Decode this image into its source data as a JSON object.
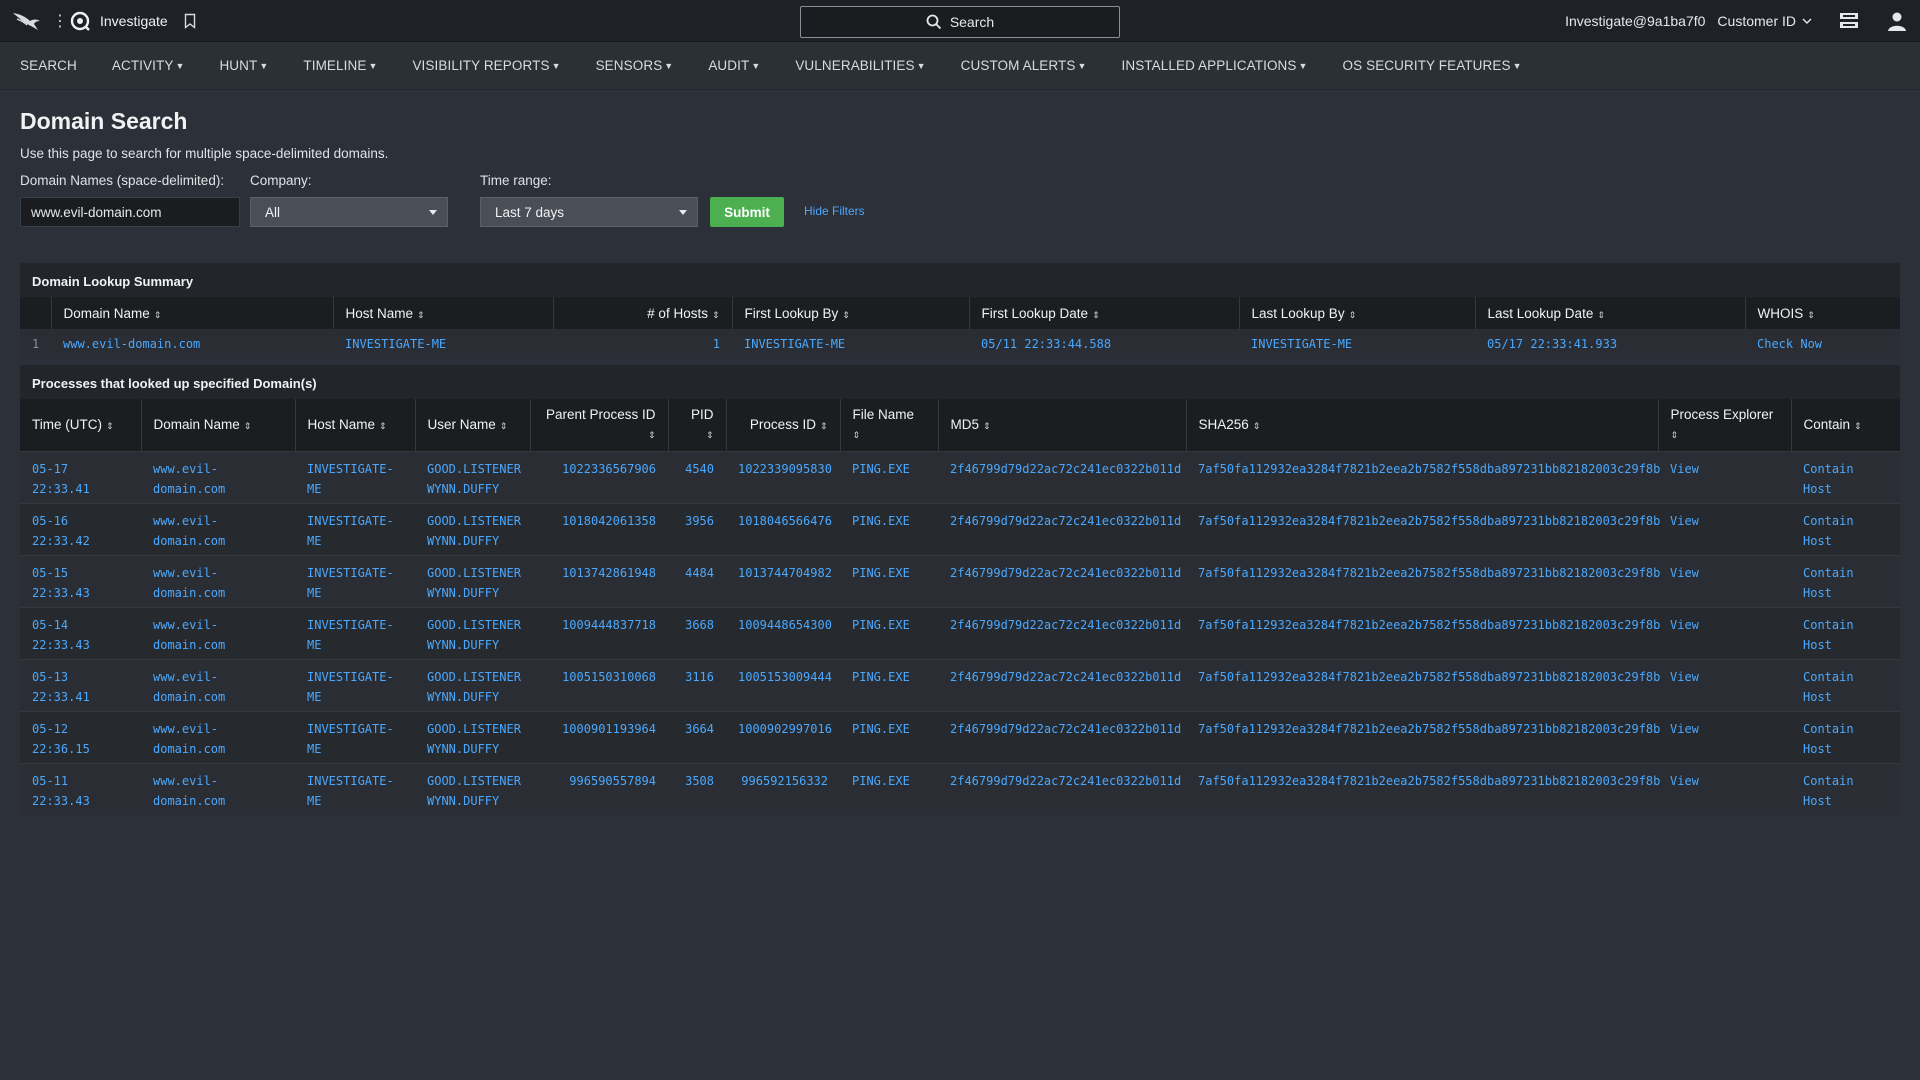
{
  "topbar": {
    "app_title": "Investigate",
    "search_label": "Search",
    "user": "Investigate@9a1ba7f0",
    "customer_label": "Customer ID"
  },
  "nav": [
    {
      "label": "SEARCH",
      "has_menu": false
    },
    {
      "label": "ACTIVITY",
      "has_menu": true
    },
    {
      "label": "HUNT",
      "has_menu": true
    },
    {
      "label": "TIMELINE",
      "has_menu": true
    },
    {
      "label": "VISIBILITY REPORTS",
      "has_menu": true
    },
    {
      "label": "SENSORS",
      "has_menu": true
    },
    {
      "label": "AUDIT",
      "has_menu": true
    },
    {
      "label": "VULNERABILITIES",
      "has_menu": true
    },
    {
      "label": "CUSTOM ALERTS",
      "has_menu": true
    },
    {
      "label": "INSTALLED APPLICATIONS",
      "has_menu": true
    },
    {
      "label": "OS SECURITY FEATURES",
      "has_menu": true
    }
  ],
  "page": {
    "title": "Domain Search",
    "description": "Use this page to search for multiple space-delimited domains."
  },
  "filters": {
    "domain_label": "Domain Names (space-delimited):",
    "domain_value": "www.evil-domain.com",
    "company_label": "Company:",
    "company_value": "All",
    "time_label": "Time range:",
    "time_value": "Last 7 days",
    "submit_label": "Submit",
    "hide_filters_label": "Hide Filters"
  },
  "summary": {
    "title": "Domain Lookup Summary",
    "columns": [
      "Domain Name",
      "Host Name",
      "# of Hosts",
      "First Lookup By",
      "First Lookup Date",
      "Last Lookup By",
      "Last Lookup Date",
      "WHOIS"
    ],
    "rows": [
      {
        "index": "1",
        "domain": "www.evil-domain.com",
        "host": "INVESTIGATE-ME",
        "hosts": "1",
        "first_by": "INVESTIGATE-ME",
        "first_date": "05/11 22:33:44.588",
        "last_by": "INVESTIGATE-ME",
        "last_date": "05/17 22:33:41.933",
        "whois": "Check Now"
      }
    ]
  },
  "processes": {
    "title": "Processes that looked up specified Domain(s)",
    "columns": [
      "Time (UTC)",
      "Domain Name",
      "Host Name",
      "User Name",
      "Parent Process ID",
      "PID",
      "Process ID",
      "File Name",
      "MD5",
      "SHA256",
      "Process Explorer",
      "Contain"
    ],
    "rows": [
      {
        "date": "05-17",
        "time": "22:33.41",
        "domain1": "www.evil-",
        "domain2": "domain.com",
        "host1": "INVESTIGATE-",
        "host2": "ME",
        "user1": "GOOD.LISTENER",
        "user2": "WYNN.DUFFY",
        "ppid": "1022336567906",
        "pid": "4540",
        "procid": "1022339095830",
        "file": "PING.EXE",
        "md5": "2f46799d79d22ac72c241ec0322b011d",
        "sha256": "7af50fa112932ea3284f7821b2eea2b7582f558dba897231bb82182003c29f8b",
        "explorer": "View",
        "contain1": "Contain",
        "contain2": "Host"
      },
      {
        "date": "05-16",
        "time": "22:33.42",
        "domain1": "www.evil-",
        "domain2": "domain.com",
        "host1": "INVESTIGATE-",
        "host2": "ME",
        "user1": "GOOD.LISTENER",
        "user2": "WYNN.DUFFY",
        "ppid": "1018042061358",
        "pid": "3956",
        "procid": "1018046566476",
        "file": "PING.EXE",
        "md5": "2f46799d79d22ac72c241ec0322b011d",
        "sha256": "7af50fa112932ea3284f7821b2eea2b7582f558dba897231bb82182003c29f8b",
        "explorer": "View",
        "contain1": "Contain",
        "contain2": "Host"
      },
      {
        "date": "05-15",
        "time": "22:33.43",
        "domain1": "www.evil-",
        "domain2": "domain.com",
        "host1": "INVESTIGATE-",
        "host2": "ME",
        "user1": "GOOD.LISTENER",
        "user2": "WYNN.DUFFY",
        "ppid": "1013742861948",
        "pid": "4484",
        "procid": "1013744704982",
        "file": "PING.EXE",
        "md5": "2f46799d79d22ac72c241ec0322b011d",
        "sha256": "7af50fa112932ea3284f7821b2eea2b7582f558dba897231bb82182003c29f8b",
        "explorer": "View",
        "contain1": "Contain",
        "contain2": "Host"
      },
      {
        "date": "05-14",
        "time": "22:33.43",
        "domain1": "www.evil-",
        "domain2": "domain.com",
        "host1": "INVESTIGATE-",
        "host2": "ME",
        "user1": "GOOD.LISTENER",
        "user2": "WYNN.DUFFY",
        "ppid": "1009444837718",
        "pid": "3668",
        "procid": "1009448654300",
        "file": "PING.EXE",
        "md5": "2f46799d79d22ac72c241ec0322b011d",
        "sha256": "7af50fa112932ea3284f7821b2eea2b7582f558dba897231bb82182003c29f8b",
        "explorer": "View",
        "contain1": "Contain",
        "contain2": "Host"
      },
      {
        "date": "05-13",
        "time": "22:33.41",
        "domain1": "www.evil-",
        "domain2": "domain.com",
        "host1": "INVESTIGATE-",
        "host2": "ME",
        "user1": "GOOD.LISTENER",
        "user2": "WYNN.DUFFY",
        "ppid": "1005150310068",
        "pid": "3116",
        "procid": "1005153009444",
        "file": "PING.EXE",
        "md5": "2f46799d79d22ac72c241ec0322b011d",
        "sha256": "7af50fa112932ea3284f7821b2eea2b7582f558dba897231bb82182003c29f8b",
        "explorer": "View",
        "contain1": "Contain",
        "contain2": "Host"
      },
      {
        "date": "05-12",
        "time": "22:36.15",
        "domain1": "www.evil-",
        "domain2": "domain.com",
        "host1": "INVESTIGATE-",
        "host2": "ME",
        "user1": "GOOD.LISTENER",
        "user2": "WYNN.DUFFY",
        "ppid": "1000901193964",
        "pid": "3664",
        "procid": "1000902997016",
        "file": "PING.EXE",
        "md5": "2f46799d79d22ac72c241ec0322b011d",
        "sha256": "7af50fa112932ea3284f7821b2eea2b7582f558dba897231bb82182003c29f8b",
        "explorer": "View",
        "contain1": "Contain",
        "contain2": "Host"
      },
      {
        "date": "05-11",
        "time": "22:33.43",
        "domain1": "www.evil-",
        "domain2": "domain.com",
        "host1": "INVESTIGATE-",
        "host2": "ME",
        "user1": "GOOD.LISTENER",
        "user2": "WYNN.DUFFY",
        "ppid": "996590557894",
        "pid": "3508",
        "procid": "996592156332",
        "file": "PING.EXE",
        "md5": "2f46799d79d22ac72c241ec0322b011d",
        "sha256": "7af50fa112932ea3284f7821b2eea2b7582f558dba897231bb82182003c29f8b",
        "explorer": "View",
        "contain1": "Contain",
        "contain2": "Host"
      }
    ]
  },
  "colors": {
    "link": "#4aa8ff",
    "submit": "#4caf50",
    "background": "#2c3038",
    "topbar": "#1e2126"
  },
  "icons": [
    "falcon-logo-icon",
    "kebab-menu-icon",
    "investigate-app-icon",
    "bookmark-icon",
    "search-icon",
    "chevron-down-icon",
    "switch-icon",
    "user-profile-icon"
  ]
}
